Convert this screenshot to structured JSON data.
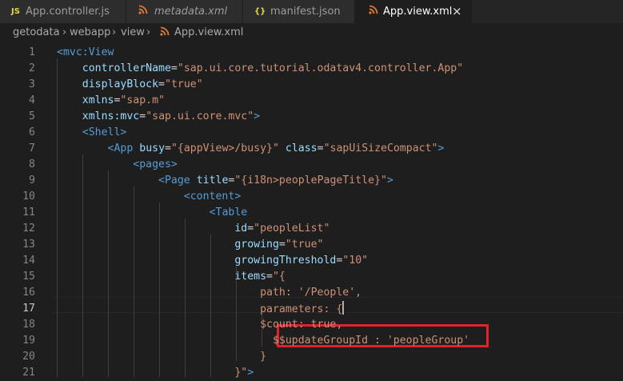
{
  "tabs": [
    {
      "icon": "JS",
      "label": "App.controller.js",
      "active": false,
      "italic": false
    },
    {
      "icon": "rss",
      "label": "metadata.xml",
      "active": false,
      "italic": true
    },
    {
      "icon": "{}",
      "label": "manifest.json",
      "active": false,
      "italic": false
    },
    {
      "icon": "rss",
      "label": "App.view.xml",
      "active": true,
      "italic": false
    }
  ],
  "close_glyph": "×",
  "breadcrumb": [
    "getodata",
    "webapp",
    "view",
    "App.view.xml"
  ],
  "breadcrumb_separator": "›",
  "current_line": 17,
  "highlighted_line": 19,
  "lines": [
    {
      "n": "1",
      "tokens": [
        [
          "t",
          "<mvc:View"
        ]
      ]
    },
    {
      "n": "2",
      "tokens": [
        [
          "c",
          "    "
        ],
        [
          "a",
          "controllerName"
        ],
        [
          "c",
          "="
        ],
        [
          "s",
          "\"sap.ui.core.tutorial.odatav4.controller.App\""
        ]
      ]
    },
    {
      "n": "3",
      "tokens": [
        [
          "c",
          "    "
        ],
        [
          "a",
          "displayBlock"
        ],
        [
          "c",
          "="
        ],
        [
          "s",
          "\"true\""
        ]
      ]
    },
    {
      "n": "4",
      "tokens": [
        [
          "c",
          "    "
        ],
        [
          "a",
          "xmlns"
        ],
        [
          "c",
          "="
        ],
        [
          "s",
          "\"sap.m\""
        ]
      ]
    },
    {
      "n": "5",
      "tokens": [
        [
          "c",
          "    "
        ],
        [
          "a",
          "xmlns:mvc"
        ],
        [
          "c",
          "="
        ],
        [
          "s",
          "\"sap.ui.core.mvc\""
        ],
        [
          "t",
          ">"
        ]
      ]
    },
    {
      "n": "6",
      "tokens": [
        [
          "c",
          "    "
        ],
        [
          "t",
          "<Shell"
        ],
        [
          "t",
          ">"
        ]
      ]
    },
    {
      "n": "7",
      "tokens": [
        [
          "c",
          "        "
        ],
        [
          "t",
          "<App"
        ],
        [
          "c",
          " "
        ],
        [
          "a",
          "busy"
        ],
        [
          "c",
          "="
        ],
        [
          "s",
          "\"{appView>/busy}\""
        ],
        [
          "c",
          " "
        ],
        [
          "a",
          "class"
        ],
        [
          "c",
          "="
        ],
        [
          "s",
          "\"sapUiSizeCompact\""
        ],
        [
          "t",
          ">"
        ]
      ]
    },
    {
      "n": "8",
      "tokens": [
        [
          "c",
          "            "
        ],
        [
          "t",
          "<pages"
        ],
        [
          "t",
          ">"
        ]
      ]
    },
    {
      "n": "9",
      "tokens": [
        [
          "c",
          "                "
        ],
        [
          "t",
          "<Page"
        ],
        [
          "c",
          " "
        ],
        [
          "a",
          "title"
        ],
        [
          "c",
          "="
        ],
        [
          "s",
          "\"{i18n>peoplePageTitle}\""
        ],
        [
          "t",
          ">"
        ]
      ]
    },
    {
      "n": "10",
      "tokens": [
        [
          "c",
          "                    "
        ],
        [
          "t",
          "<content"
        ],
        [
          "t",
          ">"
        ]
      ]
    },
    {
      "n": "11",
      "tokens": [
        [
          "c",
          "                        "
        ],
        [
          "t",
          "<Table"
        ]
      ]
    },
    {
      "n": "12",
      "tokens": [
        [
          "c",
          "                            "
        ],
        [
          "a",
          "id"
        ],
        [
          "c",
          "="
        ],
        [
          "s",
          "\"peopleList\""
        ]
      ]
    },
    {
      "n": "13",
      "tokens": [
        [
          "c",
          "                            "
        ],
        [
          "a",
          "growing"
        ],
        [
          "c",
          "="
        ],
        [
          "s",
          "\"true\""
        ]
      ]
    },
    {
      "n": "14",
      "tokens": [
        [
          "c",
          "                            "
        ],
        [
          "a",
          "growingThreshold"
        ],
        [
          "c",
          "="
        ],
        [
          "s",
          "\"10\""
        ]
      ]
    },
    {
      "n": "15",
      "tokens": [
        [
          "c",
          "                            "
        ],
        [
          "a",
          "items"
        ],
        [
          "c",
          "="
        ],
        [
          "s",
          "\"{"
        ]
      ]
    },
    {
      "n": "16",
      "tokens": [
        [
          "c",
          "                                "
        ],
        [
          "s",
          "path: '/People',"
        ]
      ]
    },
    {
      "n": "17",
      "tokens": [
        [
          "c",
          "                                "
        ],
        [
          "s",
          "parameters: {"
        ]
      ]
    },
    {
      "n": "18",
      "tokens": [
        [
          "c",
          "                                "
        ],
        [
          "s",
          "$count: true,"
        ]
      ]
    },
    {
      "n": "19",
      "tokens": [
        [
          "c",
          "                                  "
        ],
        [
          "s",
          "$$updateGroupId : 'peopleGroup'"
        ]
      ]
    },
    {
      "n": "20",
      "tokens": [
        [
          "c",
          "                                "
        ],
        [
          "s",
          "}"
        ]
      ]
    },
    {
      "n": "21",
      "tokens": [
        [
          "c",
          "                            "
        ],
        [
          "s",
          "}\""
        ],
        [
          "t",
          ">"
        ]
      ]
    }
  ]
}
